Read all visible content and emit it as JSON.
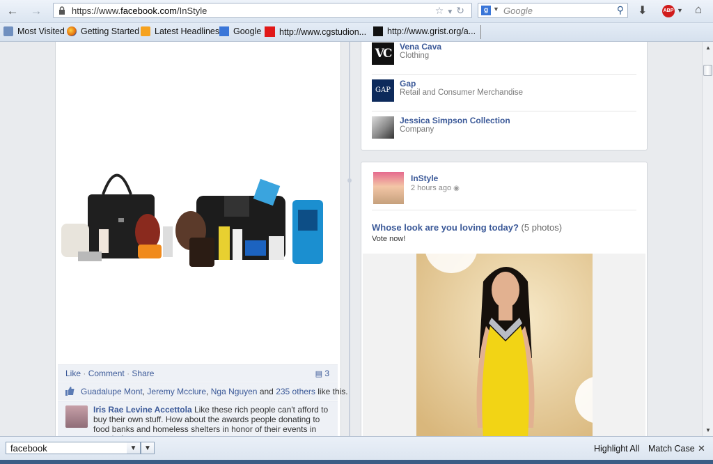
{
  "browser": {
    "url_prefix": "https://www.",
    "url_host": "facebook.com",
    "url_path": "/InStyle",
    "search_engine": "Google",
    "search_placeholder": "Google",
    "addon_label": "ABP"
  },
  "bookmarks": [
    {
      "label": "Most Visited",
      "icon": "most-visited-icon"
    },
    {
      "label": "Getting Started",
      "icon": "firefox-icon"
    },
    {
      "label": "Latest Headlines",
      "icon": "rss-icon"
    },
    {
      "label": "Google",
      "icon": "google-icon"
    },
    {
      "label": "http://www.cgstudion...",
      "icon": "red-square-icon"
    },
    {
      "label": "http://www.grist.org/a...",
      "icon": "grist-icon"
    }
  ],
  "left_post": {
    "actions": {
      "like": "Like",
      "comment": "Comment",
      "share": "Share",
      "sep": "·"
    },
    "comment_count": "3",
    "likers": [
      "Guadalupe Mont",
      "Jeremy Mcclure",
      "Nga Nguyen"
    ],
    "likers_and": "and",
    "others": "235 others",
    "likes_suffix": "like this.",
    "comment": {
      "author": "Iris Rae Levine Accettola",
      "text": "Like these rich people can't afford to buy their own stuff. How about the awards people donating to food banks and homeless shelters in honor of their events in stead of"
    }
  },
  "pages_list": [
    {
      "name": "Vena Cava",
      "category": "Clothing",
      "logo": "VC"
    },
    {
      "name": "Gap",
      "category": "Retail and Consumer Merchandise",
      "logo": "GAP"
    },
    {
      "name": "Jessica Simpson Collection",
      "category": "Company",
      "logo": ""
    }
  ],
  "right_post": {
    "author": "InStyle",
    "time": "2 hours ago",
    "title": "Whose look are you loving today?",
    "photos_note": "(5 photos)",
    "subtitle": "Vote now!"
  },
  "findbar": {
    "query": "facebook",
    "highlight_all": "Highlight All",
    "match_case": "Match Case"
  },
  "colors": {
    "fb_link": "#3b5998",
    "page_bg": "#e9ebee"
  }
}
